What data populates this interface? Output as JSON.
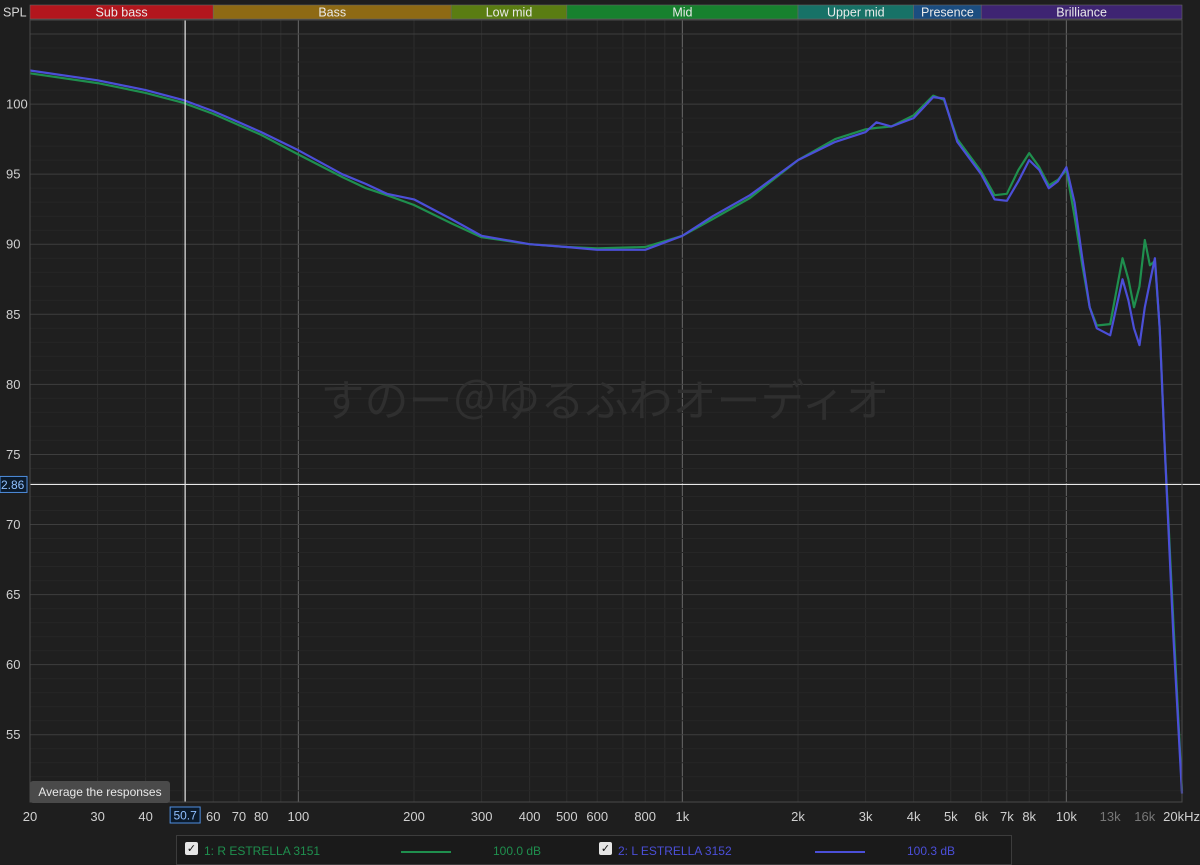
{
  "chart_data": {
    "type": "line",
    "ylabel": "SPL",
    "x_scale": "log",
    "xlim": [
      20,
      20000
    ],
    "ylim": [
      50.2,
      106
    ],
    "grid": true,
    "x_ticks": [
      {
        "v": 20,
        "label": "20"
      },
      {
        "v": 30,
        "label": "30"
      },
      {
        "v": 40,
        "label": "40"
      },
      {
        "v": 60,
        "label": "60"
      },
      {
        "v": 70,
        "label": "70"
      },
      {
        "v": 80,
        "label": "80"
      },
      {
        "v": 100,
        "label": "100"
      },
      {
        "v": 200,
        "label": "200"
      },
      {
        "v": 300,
        "label": "300"
      },
      {
        "v": 400,
        "label": "400"
      },
      {
        "v": 500,
        "label": "500"
      },
      {
        "v": 600,
        "label": "600"
      },
      {
        "v": 800,
        "label": "800"
      },
      {
        "v": 1000,
        "label": "1k"
      },
      {
        "v": 2000,
        "label": "2k"
      },
      {
        "v": 3000,
        "label": "3k"
      },
      {
        "v": 4000,
        "label": "4k"
      },
      {
        "v": 5000,
        "label": "5k"
      },
      {
        "v": 6000,
        "label": "6k"
      },
      {
        "v": 7000,
        "label": "7k"
      },
      {
        "v": 8000,
        "label": "8k"
      },
      {
        "v": 10000,
        "label": "10k"
      },
      {
        "v": 13000,
        "label": "13k",
        "dim": true
      },
      {
        "v": 16000,
        "label": "16k",
        "dim": true
      },
      {
        "v": 20000,
        "label": "20kHz"
      }
    ],
    "y_ticks": [
      55,
      60,
      65,
      70,
      75,
      80,
      85,
      90,
      95,
      100
    ],
    "bands": [
      {
        "name": "Sub bass",
        "from": 20,
        "to": 60,
        "color": "#b3161d"
      },
      {
        "name": "Bass",
        "from": 60,
        "to": 250,
        "color": "#8e6a14"
      },
      {
        "name": "Low mid",
        "from": 250,
        "to": 500,
        "color": "#5a7d12"
      },
      {
        "name": "Mid",
        "from": 500,
        "to": 2000,
        "color": "#17812e"
      },
      {
        "name": "Upper mid",
        "from": 2000,
        "to": 4000,
        "color": "#177267"
      },
      {
        "name": "Presence",
        "from": 4000,
        "to": 6000,
        "color": "#1b4d80"
      },
      {
        "name": "Brilliance",
        "from": 6000,
        "to": 20000,
        "color": "#3e2472"
      }
    ],
    "cursor": {
      "x": 50.7,
      "x_label": "50.7",
      "y": 72.86,
      "y_label": "2.86"
    },
    "watermark": "すのー＠ゆるふわオーディオ",
    "series": [
      {
        "name": "1: R ESTRELLA 3151",
        "color": "#1f8f4e",
        "level": "100.0 dB",
        "points": [
          [
            20,
            102.2
          ],
          [
            30,
            101.5
          ],
          [
            40,
            100.8
          ],
          [
            50,
            100.1
          ],
          [
            60,
            99.3
          ],
          [
            70,
            98.5
          ],
          [
            80,
            97.8
          ],
          [
            100,
            96.4
          ],
          [
            130,
            94.8
          ],
          [
            150,
            94.0
          ],
          [
            170,
            93.5
          ],
          [
            200,
            92.8
          ],
          [
            250,
            91.5
          ],
          [
            300,
            90.5
          ],
          [
            400,
            90.0
          ],
          [
            500,
            89.8
          ],
          [
            600,
            89.7
          ],
          [
            800,
            89.8
          ],
          [
            1000,
            90.6
          ],
          [
            1200,
            91.8
          ],
          [
            1500,
            93.3
          ],
          [
            2000,
            96.0
          ],
          [
            2500,
            97.5
          ],
          [
            3000,
            98.2
          ],
          [
            3200,
            98.3
          ],
          [
            3500,
            98.4
          ],
          [
            4000,
            99.2
          ],
          [
            4500,
            100.6
          ],
          [
            4800,
            100.3
          ],
          [
            5200,
            97.5
          ],
          [
            6000,
            95.2
          ],
          [
            6500,
            93.5
          ],
          [
            7000,
            93.6
          ],
          [
            7500,
            95.3
          ],
          [
            8000,
            96.5
          ],
          [
            8500,
            95.5
          ],
          [
            9000,
            94.2
          ],
          [
            9500,
            94.6
          ],
          [
            10000,
            95.3
          ],
          [
            10500,
            92.0
          ],
          [
            11000,
            88.5
          ],
          [
            11500,
            85.5
          ],
          [
            12000,
            84.2
          ],
          [
            13000,
            84.3
          ],
          [
            14000,
            89.0
          ],
          [
            14500,
            87.5
          ],
          [
            15000,
            85.5
          ],
          [
            15500,
            87.0
          ],
          [
            16000,
            90.3
          ],
          [
            16500,
            88.5
          ],
          [
            17000,
            88.8
          ],
          [
            17500,
            84.0
          ],
          [
            18000,
            76.0
          ],
          [
            19000,
            63.0
          ],
          [
            20000,
            51.0
          ]
        ]
      },
      {
        "name": "2: L ESTRELLA 3152",
        "color": "#4b4fd8",
        "level": "100.3 dB",
        "points": [
          [
            20,
            102.4
          ],
          [
            30,
            101.7
          ],
          [
            40,
            101.0
          ],
          [
            50,
            100.3
          ],
          [
            60,
            99.5
          ],
          [
            70,
            98.7
          ],
          [
            80,
            98.0
          ],
          [
            100,
            96.7
          ],
          [
            130,
            95.0
          ],
          [
            150,
            94.3
          ],
          [
            170,
            93.6
          ],
          [
            200,
            93.2
          ],
          [
            250,
            91.8
          ],
          [
            300,
            90.6
          ],
          [
            400,
            90.0
          ],
          [
            500,
            89.8
          ],
          [
            600,
            89.6
          ],
          [
            800,
            89.6
          ],
          [
            1000,
            90.6
          ],
          [
            1200,
            92.0
          ],
          [
            1500,
            93.5
          ],
          [
            2000,
            96.0
          ],
          [
            2500,
            97.3
          ],
          [
            3000,
            98.0
          ],
          [
            3200,
            98.7
          ],
          [
            3500,
            98.4
          ],
          [
            4000,
            99.0
          ],
          [
            4500,
            100.5
          ],
          [
            4800,
            100.4
          ],
          [
            5200,
            97.3
          ],
          [
            6000,
            95.0
          ],
          [
            6500,
            93.2
          ],
          [
            7000,
            93.1
          ],
          [
            7500,
            94.5
          ],
          [
            8000,
            96.0
          ],
          [
            8500,
            95.3
          ],
          [
            9000,
            94.0
          ],
          [
            9500,
            94.5
          ],
          [
            10000,
            95.5
          ],
          [
            10500,
            93.0
          ],
          [
            11000,
            89.0
          ],
          [
            11500,
            85.5
          ],
          [
            12000,
            84.0
          ],
          [
            13000,
            83.5
          ],
          [
            14000,
            87.5
          ],
          [
            14500,
            86.0
          ],
          [
            15000,
            84.0
          ],
          [
            15500,
            82.8
          ],
          [
            16000,
            85.5
          ],
          [
            16500,
            87.3
          ],
          [
            17000,
            89.0
          ],
          [
            17500,
            84.0
          ],
          [
            18000,
            76.0
          ],
          [
            19000,
            62.0
          ],
          [
            20000,
            50.8
          ]
        ]
      }
    ]
  },
  "controls": {
    "average_button": "Average the responses"
  }
}
